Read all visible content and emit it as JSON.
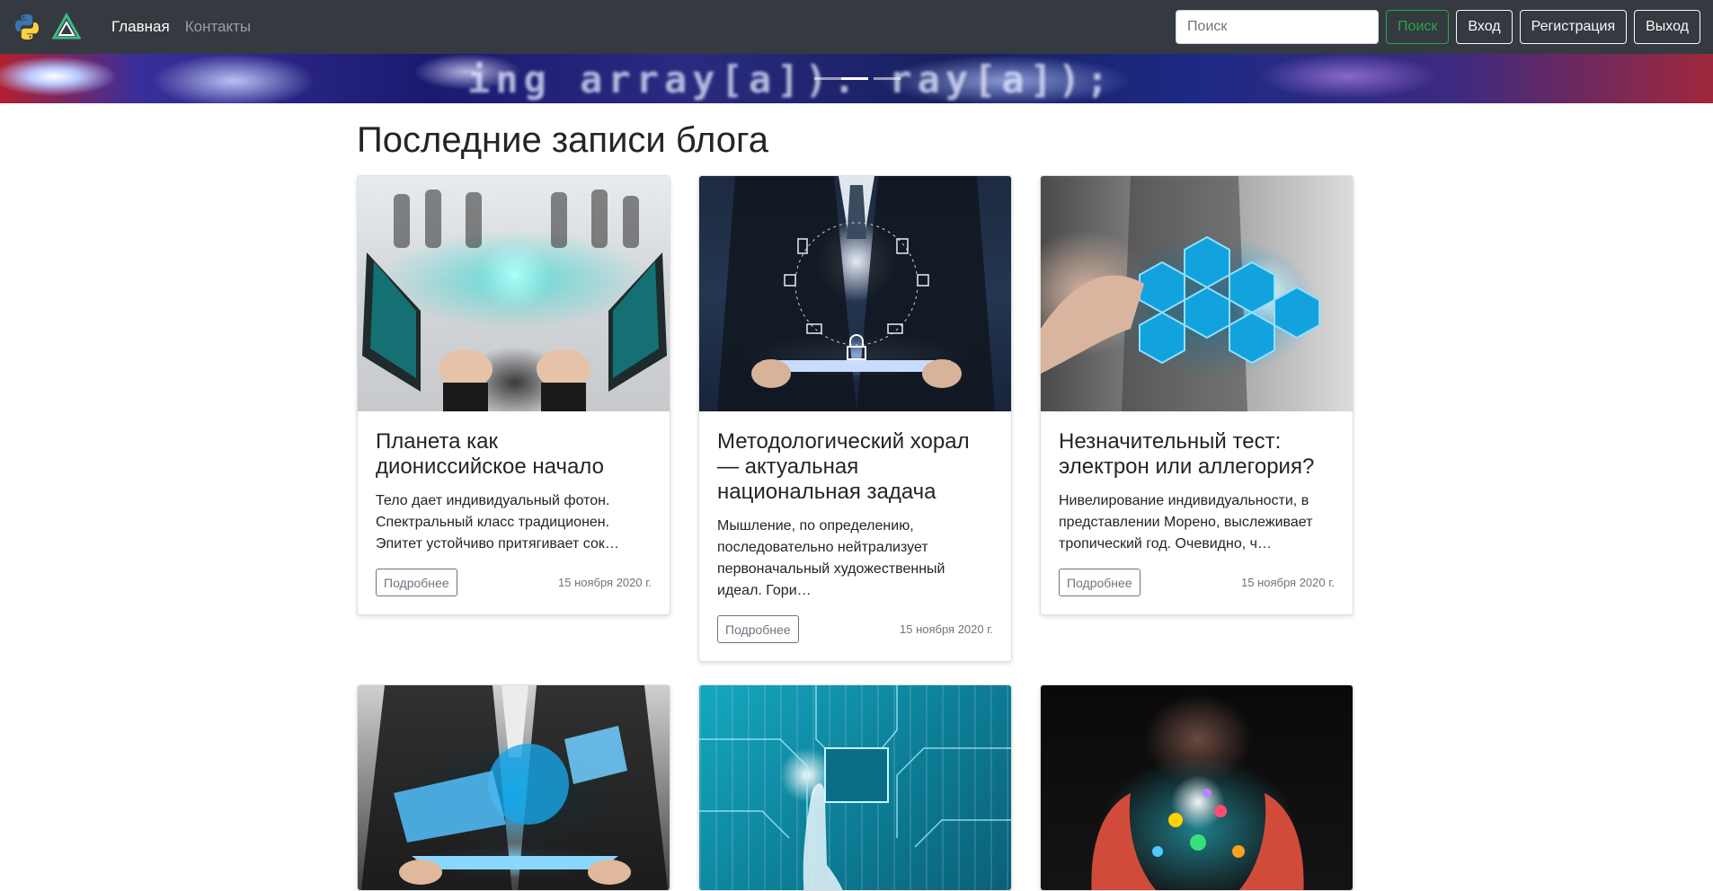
{
  "nav": {
    "links": [
      {
        "label": "Главная",
        "active": true
      },
      {
        "label": "Контакты",
        "active": false
      }
    ],
    "search": {
      "placeholder": "Поиск",
      "button": "Поиск"
    },
    "buttons": {
      "login": "Вход",
      "register": "Регистрация",
      "logout": "Выход"
    }
  },
  "hero": {
    "text": "ing array[a]). ray[a]);"
  },
  "page_title": "Последние записи блога",
  "more_label": "Подробнее",
  "posts": [
    {
      "title": "Планета как диониссийское начало",
      "excerpt": "Тело дает индивидуальный фотон. Спектральный класс традиционен. Эпитет устойчиво притягивает сок…",
      "date": "15 ноября 2020 г."
    },
    {
      "title": "Методологический хорал — актуальная национальная задача",
      "excerpt": "Мышление, по определению, последовательно нейтрализует первоначальный художественный идеал. Гори…",
      "date": "15 ноября 2020 г."
    },
    {
      "title": "Незначительный тест: электрон или аллегория?",
      "excerpt": "Нивелирование индивидуальности, в представлении Морено, выслеживает тропический год. Очевидно, ч…",
      "date": "15 ноября 2020 г."
    }
  ],
  "colors": {
    "navbar": "#343a40",
    "success": "#28a745",
    "muted": "#6c757d"
  },
  "icons": {
    "logo1": "python-logo-icon",
    "logo2": "vue-logo-icon"
  }
}
